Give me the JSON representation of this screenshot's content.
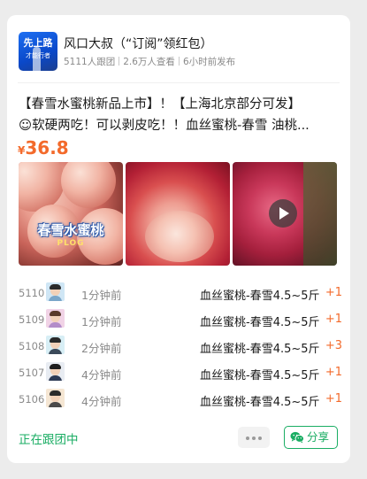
{
  "header": {
    "avatar_line1": "先上路",
    "avatar_line2": "才能行者",
    "author_name": "风口大叔（“订阅”领红包）",
    "followers": "5111人跟团",
    "views": "2.6万人查看",
    "posted": "6小时前发布"
  },
  "post": {
    "line1": "【春雪水蜜桃新品上市】！【上海北京部分可发】",
    "line2": "☺软硬两吃！可以剥皮吃！！血丝蜜桃-春雪 油桃...",
    "price_currency": "¥",
    "price_value": "36.8",
    "image1_caption": "春雪水蜜桃",
    "image1_tag": "PLOG"
  },
  "orders": [
    {
      "no": "5110",
      "time": "1分钟前",
      "product": "血丝蜜桃-春雪4.5~5斤",
      "qty": "+1"
    },
    {
      "no": "5109",
      "time": "1分钟前",
      "product": "血丝蜜桃-春雪4.5~5斤",
      "qty": "+1"
    },
    {
      "no": "5108",
      "time": "2分钟前",
      "product": "血丝蜜桃-春雪4.5~5斤",
      "qty": "+3"
    },
    {
      "no": "5107",
      "time": "4分钟前",
      "product": "血丝蜜桃-春雪4.5~5斤",
      "qty": "+1"
    },
    {
      "no": "5106",
      "time": "4分钟前",
      "product": "血丝蜜桃-春雪4.5~5斤",
      "qty": "+1"
    }
  ],
  "footer": {
    "status": "正在跟团中",
    "share_label": "分享"
  },
  "colors": {
    "accent_green": "#1aad63",
    "price_orange": "#f36a2b"
  },
  "icons": {
    "more": "more-dots-icon",
    "share": "wechat-icon",
    "play": "play-icon"
  }
}
